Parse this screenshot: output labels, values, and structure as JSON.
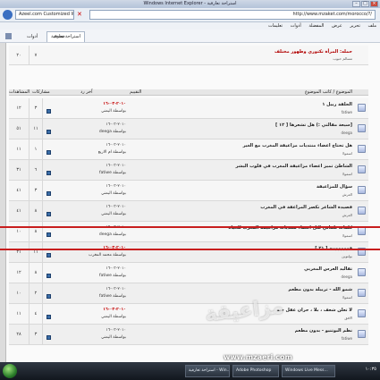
{
  "window": {
    "title": "Windows Internet Explorer - استراحة تعارفية"
  },
  "address": {
    "url": "http://www.mzaket.com/morocco/?/",
    "search": "Azeel.com Customized Web Search"
  },
  "menu": [
    "ملف",
    "تحرير",
    "عرض",
    "المفضلة",
    "أدوات",
    "تعليمات"
  ],
  "toolbar": {
    "tab": "استراحة تعارفية",
    "tools": [
      "صفحة",
      "أدوات"
    ]
  },
  "header": {
    "topic": "الموضوع / كاتب الموضوع",
    "rating": "التقييم",
    "last_post": "آخر رد",
    "replies": "مشاركات",
    "views": "المشاهدات"
  },
  "top_row": {
    "title": "حمله: المرأة تكتوري وطهور مختلف",
    "author": "مسالم حبوب",
    "num": "٧",
    "views": "٢٠"
  },
  "rows": [
    {
      "title": "الحلقة ربيل ١",
      "author": "fatiwe",
      "date": "٢٠١٠-٠٣-١٦",
      "by": "بواسطة اليمني",
      "replies": "٣",
      "views": "١٢",
      "red": true
    },
    {
      "title": "[سيعة مقالتي :) هل تشعرها [ ١٢ ]",
      "author": "deega",
      "date": "٢٠١٠-٠٣-١٦",
      "by": "بواسطة deega",
      "replies": "١١",
      "views": "٥١",
      "red": false
    },
    {
      "title": "هل تحتاج اعضاء منتديات مزاعيقة المغرب مع الغير",
      "author": "اسمولا",
      "date": "٢٠١٠-٠٣-١٦",
      "by": "بواسطة ام الاربع",
      "replies": "١",
      "views": "١١",
      "red": false
    },
    {
      "title": "الشاطئ تميز اعضاء مزاعيقة المغرب في قلوب البشر",
      "author": "اسمولا",
      "date": "٢٠١٠-٠٣-١٦",
      "by": "بواسطة fatiwe",
      "replies": "٦",
      "views": "٣١",
      "red": false
    },
    {
      "title": "سؤال للمزاعيقة",
      "author": "العرش",
      "date": "٢٠١٠-٠٣-١٦",
      "by": "بواسطة اليمني",
      "replies": "٣",
      "views": "٤١",
      "red": false
    },
    {
      "title": "قصيدة الشاعر نكصر المراعقة في المغرب",
      "author": "العرش",
      "date": "٢٠١٠-٠٣-١٦",
      "by": "بواسطة اليمني",
      "replies": "٨",
      "views": "٤١",
      "red": false
    },
    {
      "title": "كلمات تلقائي لكل اعضاء منتديات مزاعيقة المغرب للحياة",
      "author": "اسمولا",
      "date": "٢٠١٠-٠٣-١٦",
      "by": "بواسطة deega",
      "replies": "٨",
      "views": "١٠",
      "red": false
    },
    {
      "title": "فوووووييه [ ٢١ ]",
      "author": "بولتوين",
      "date": "٢٠١٠-٠٣-١٦",
      "by": "بواسطة محمد المغرب",
      "replies": "١١",
      "views": "٢١",
      "red": true
    },
    {
      "title": "تقاليد العرس المغربي",
      "author": "deega",
      "date": "٢٠١٠-٠٣-١٦",
      "by": "بواسطة fatiwe",
      "replies": "٨",
      "views": "١٢",
      "red": false
    },
    {
      "title": "شمو الله - تربيلة بدون مطعم",
      "author": "اسمولا",
      "date": "٢٠١٠-٠٣-١٦",
      "by": "بواسطة fatiwe",
      "replies": "٢",
      "views": "١٠",
      "red": false
    },
    {
      "title": "لا تعلن شعف ، بلا ، حران عقل جيد",
      "author": "الافق",
      "date": "٢٠١٠-٠٣-١٦",
      "by": "بواسطة اليمني",
      "replies": "٤",
      "views": "١١",
      "red": true
    },
    {
      "title": "نظم البوتنيو - بدون مطعم",
      "author": "fatiwe",
      "date": "٢٠١٠-٠٣-١٦",
      "by": "بواسطة اليمني",
      "replies": "٣",
      "views": "٢٨",
      "red": false
    }
  ],
  "taskbar": {
    "items": [
      "استراحة تعارفية - Win...",
      "Adobe Photoshop",
      "Windows Live Mess..."
    ],
    "clock": "١٠:٣٥"
  },
  "watermark": {
    "text": "www.mzaeri.com"
  }
}
